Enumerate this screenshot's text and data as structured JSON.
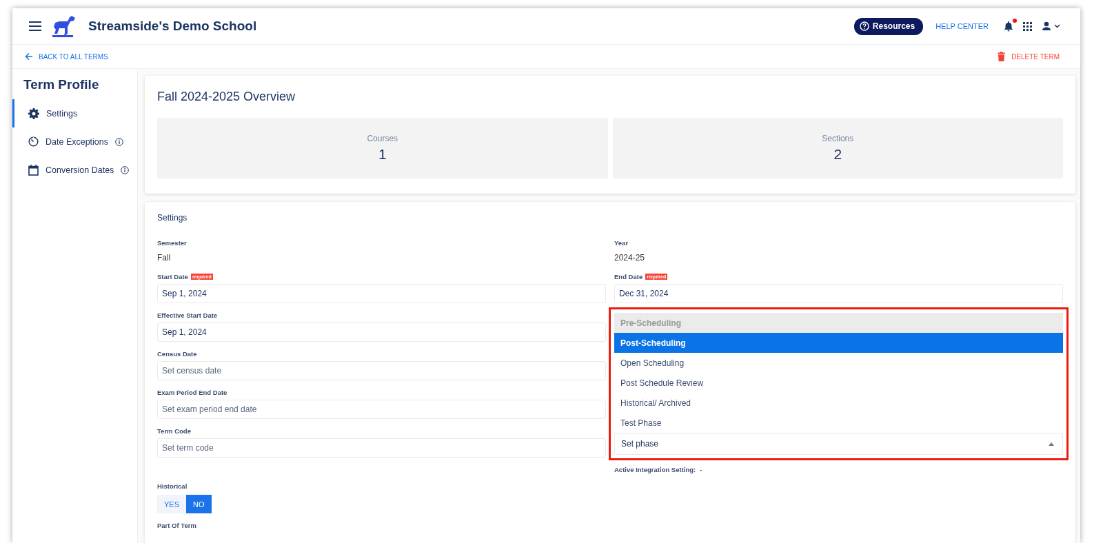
{
  "header": {
    "title": "Streamside's Demo School",
    "resources_button": "Resources",
    "help_link": "HELP CENTER",
    "notifications_unread": true
  },
  "nav": {
    "back_link": "BACK TO ALL TERMS",
    "delete_button": "DELETE TERM"
  },
  "sidebar": {
    "title": "Term Profile",
    "items": [
      {
        "label": "Settings",
        "kind": "gear",
        "info": false,
        "selected": true
      },
      {
        "label": "Date Exceptions",
        "kind": "timer",
        "info": true,
        "selected": false
      },
      {
        "label": "Conversion Dates",
        "kind": "calendar",
        "info": true,
        "selected": false
      }
    ]
  },
  "overview": {
    "title": "Fall 2024-2025 Overview",
    "stats": [
      {
        "label": "Courses",
        "value": "1"
      },
      {
        "label": "Sections",
        "value": "2"
      }
    ]
  },
  "settings": {
    "title": "Settings",
    "left": [
      {
        "kind": "static",
        "label": "Semester",
        "value": "Fall"
      },
      {
        "kind": "input",
        "label": "Start Date",
        "badge": "required",
        "value": "Sep 1, 2024"
      },
      {
        "kind": "input",
        "label": "Effective Start Date",
        "value": "Sep 1, 2024"
      },
      {
        "kind": "input",
        "label": "Census Date",
        "placeholder": "Set census date"
      },
      {
        "kind": "input",
        "label": "Exam Period End Date",
        "placeholder": "Set exam period end date"
      },
      {
        "kind": "input",
        "label": "Term Code",
        "placeholder": "Set term code"
      },
      {
        "kind": "toggle",
        "label": "Historical",
        "options": [
          {
            "label": "YES",
            "selected": false
          },
          {
            "label": "NO",
            "selected": true
          }
        ]
      },
      {
        "kind": "heading",
        "label": "Part Of Term"
      }
    ],
    "right": [
      {
        "kind": "static",
        "label": "Year",
        "value": "2024-25"
      },
      {
        "kind": "input",
        "label": "End Date",
        "badge": "required",
        "value": "Dec 31, 2024"
      },
      {
        "kind": "select",
        "placeholder": "Set phase",
        "expanded": true,
        "options": [
          {
            "label": "Pre-Scheduling",
            "disabled": true,
            "selected": false
          },
          {
            "label": "Post-Scheduling",
            "disabled": false,
            "selected": true
          },
          {
            "label": "Open Scheduling",
            "disabled": false,
            "selected": false
          },
          {
            "label": "Post Schedule Review",
            "disabled": false,
            "selected": false
          },
          {
            "label": "Historical/ Archived",
            "disabled": false,
            "selected": false
          },
          {
            "label": "Test Phase",
            "disabled": false,
            "selected": false
          }
        ]
      },
      {
        "kind": "info",
        "label": "Active Integration Setting:",
        "value": "-"
      }
    ]
  }
}
